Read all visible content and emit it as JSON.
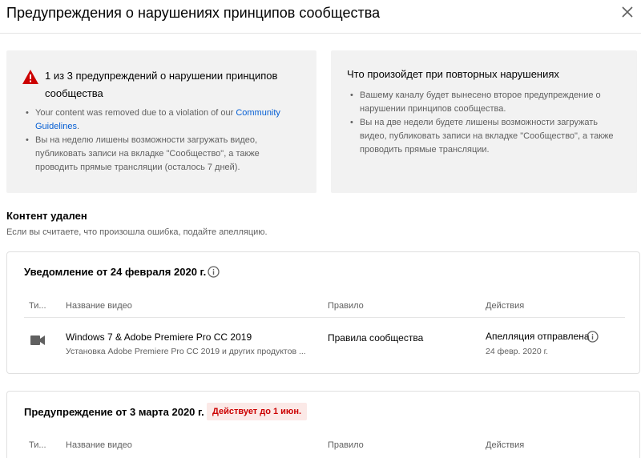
{
  "header": {
    "title": "Предупреждения о нарушениях принципов сообщества"
  },
  "strike_card": {
    "title": "1 из 3 предупреждений о нарушении принципов сообщества",
    "bullet1_prefix": "Your content was removed due to a violation of our ",
    "bullet1_link": "Community Guidelines",
    "bullet1_suffix": ".",
    "bullet2": "Вы на неделю лишены возможности загружать видео, публиковать записи на вкладке \"Сообщество\", а также проводить прямые трансляции (осталось 7 дней)."
  },
  "repeat_card": {
    "title": "Что произойдет при повторных нарушениях",
    "bullet1": "Вашему каналу будет вынесено второе предупреждение о нарушении принципов сообщества.",
    "bullet2": "Вы на две недели будете лишены возможности загружать видео, публиковать записи на вкладке \"Сообщество\", а также проводить прямые трансляции."
  },
  "content_removed": {
    "title": "Контент удален",
    "subtitle": "Если вы считаете, что произошла ошибка, подайте апелляцию."
  },
  "table_headers": {
    "type": "Ти...",
    "video_name": "Название видео",
    "rule": "Правило",
    "actions": "Действия"
  },
  "notice_panel": {
    "title": "Уведомление от 24 февраля 2020 г.",
    "rows": [
      {
        "icon": "video-camera-icon",
        "video_title": "Windows 7 & Adobe Premiere Pro CC 2019",
        "video_desc": "Установка Adobe Premiere Pro CC 2019 и других продуктов ...",
        "rule": "Правила сообщества",
        "action": "Апелляция отправлена",
        "action_date": "24 февр. 2020 г."
      }
    ]
  },
  "warning_panel": {
    "title": "Предупреждение от 3 марта 2020 г.",
    "badge": "Действует до 1 июн."
  },
  "colors": {
    "link": "#065fd4",
    "warning_red": "#cc0000",
    "badge_bg": "#fbe9e7",
    "card_bg": "#f2f2f2"
  }
}
